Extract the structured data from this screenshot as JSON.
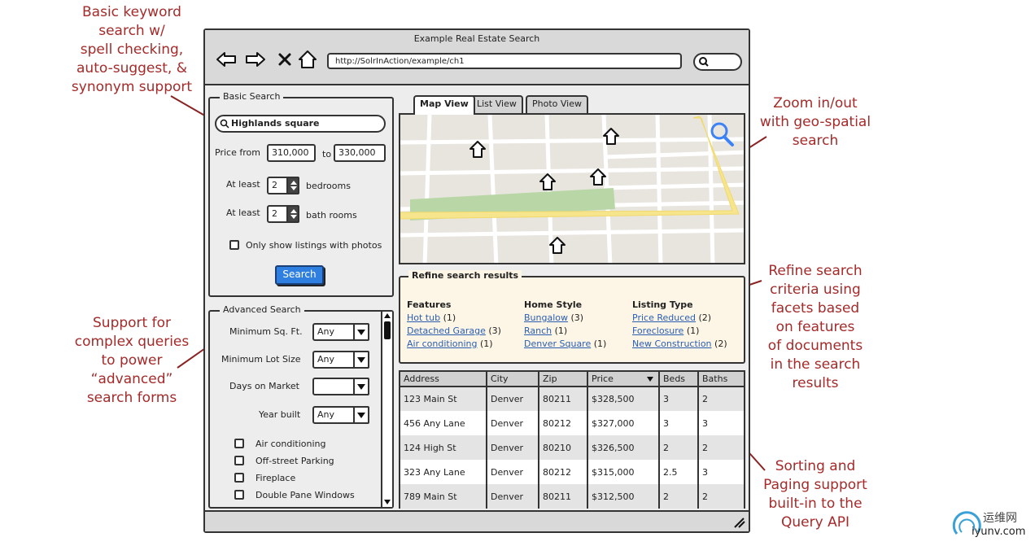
{
  "annotations": {
    "basic_search": "Basic keyword\nsearch w/\nspell checking,\nauto-suggest, &\nsynonym support",
    "advanced": "Support for\ncomplex queries\nto power\n“advanced”\nsearch forms",
    "zoom": "Zoom in/out\nwith geo-spatial\nsearch",
    "refine": "Refine search\ncriteria using\nfacets based\non features\nof documents\nin the search\nresults",
    "sorting": "Sorting and\nPaging support\nbuilt-in to the\nQuery API"
  },
  "window": {
    "title": "Example Real Estate Search",
    "url": "http://SolrInAction/example/ch1"
  },
  "basic_search": {
    "legend": "Basic Search",
    "query": "Highlands square",
    "price_from_label": "Price from",
    "price_min": "310,000",
    "price_to_label": "to",
    "price_max": "330,000",
    "at_least_1": "At least",
    "bedrooms_value": "2",
    "bedrooms_label": "bedrooms",
    "at_least_2": "At least",
    "baths_value": "2",
    "baths_label": "bath rooms",
    "photos_label": "Only show listings with photos",
    "search_button": "Search"
  },
  "advanced_search": {
    "legend": "Advanced Search",
    "min_sqft_label": "Minimum Sq. Ft.",
    "min_sqft_value": "Any",
    "min_lot_label": "Minimum Lot Size",
    "min_lot_value": "Any",
    "days_label": "Days on Market",
    "days_value": "",
    "year_label": "Year built",
    "year_value": "Any",
    "checkboxes": [
      "Air conditioning",
      "Off-street Parking",
      "Fireplace",
      "Double Pane Windows"
    ]
  },
  "tabs": [
    "Map View",
    "List View",
    "Photo View"
  ],
  "facets": {
    "legend": "Refine search results",
    "columns": [
      {
        "header": "Features",
        "items": [
          {
            "label": "Hot tub",
            "count": "(1)"
          },
          {
            "label": "Detached Garage",
            "count": "(3)"
          },
          {
            "label": "Air conditioning",
            "count": "(1)"
          }
        ]
      },
      {
        "header": "Home Style",
        "items": [
          {
            "label": "Bungalow",
            "count": "(3)"
          },
          {
            "label": "Ranch",
            "count": "(1)"
          },
          {
            "label": "Denver Square",
            "count": "(1)"
          }
        ]
      },
      {
        "header": "Listing Type",
        "items": [
          {
            "label": "Price Reduced",
            "count": "(2)"
          },
          {
            "label": "Foreclosure",
            "count": "(1)"
          },
          {
            "label": "New Construction",
            "count": "(2)"
          }
        ]
      }
    ]
  },
  "results": {
    "columns": [
      "Address",
      "City",
      "Zip",
      "Price",
      "Beds",
      "Baths"
    ],
    "rows": [
      [
        "123 Main St",
        "Denver",
        "80211",
        "$328,500",
        "3",
        "2"
      ],
      [
        "456 Any Lane",
        "Denver",
        "80212",
        "$327,000",
        "3",
        "3"
      ],
      [
        "124 High St",
        "Denver",
        "80210",
        "$326,500",
        "2",
        "2"
      ],
      [
        "323 Any Lane",
        "Denver",
        "80212",
        "$315,000",
        "2.5",
        "3"
      ],
      [
        "789 Main St",
        "Denver",
        "80211",
        "$312,500",
        "2",
        "2"
      ]
    ]
  },
  "watermark": {
    "cn": "运维网",
    "domain": "iyunv.com"
  },
  "colors": {
    "annotation": "#a52a2a",
    "search_button": "#2f7fe0",
    "link": "#2a5db0",
    "facet_bg": "#fdf6e6",
    "map_park": "#b9d7a6",
    "map_road_major": "#f6e58d"
  }
}
